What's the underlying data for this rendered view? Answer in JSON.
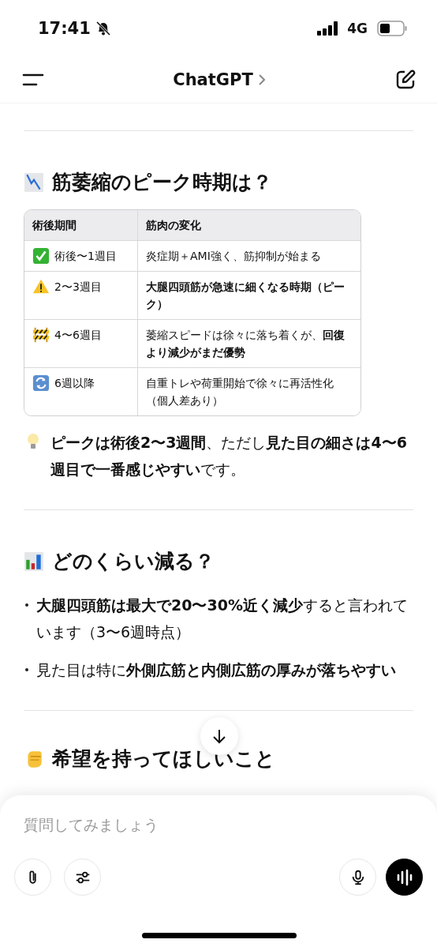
{
  "status_bar": {
    "time": "17:41",
    "network": "4G"
  },
  "header": {
    "title": "ChatGPT"
  },
  "sections": [
    {
      "heading": "筋萎縮のピーク時期は？",
      "table": {
        "columns": [
          "術後期間",
          "筋肉の変化"
        ],
        "rows": [
          {
            "kind": "check",
            "period": "術後〜1週目",
            "change": "炎症期＋AMI強く、筋抑制が始まる",
            "bold": false
          },
          {
            "kind": "warning",
            "period": "2〜3週目",
            "change": "大腿四頭筋が急速に細くなる時期（ピーク）",
            "bold": true
          },
          {
            "kind": "barrier",
            "period": "4〜6週目",
            "change": "萎縮スピードは徐々に落ち着くが、**回復より減少がまだ優勢**",
            "bold": false
          },
          {
            "kind": "repeat",
            "period": "6週以降",
            "change": "自重トレや荷重開始で徐々に再活性化（個人差あり）",
            "bold": false
          }
        ]
      },
      "tip": {
        "text": "**ピークは術後2〜3週間**、ただし**見た目の細さは4〜6週目で一番感じやすい**です。"
      }
    },
    {
      "heading": "どのくらい減る？",
      "bullets": [
        "**大腿四頭筋は最大で20〜30%近く減少**すると言われています（3〜6週時点）",
        "見た目は特に**外側広筋と内側広筋の厚みが落ちやすい**"
      ]
    },
    {
      "heading": "希望を持ってほしいこと"
    }
  ],
  "composer": {
    "placeholder": "質問してみましょう"
  }
}
